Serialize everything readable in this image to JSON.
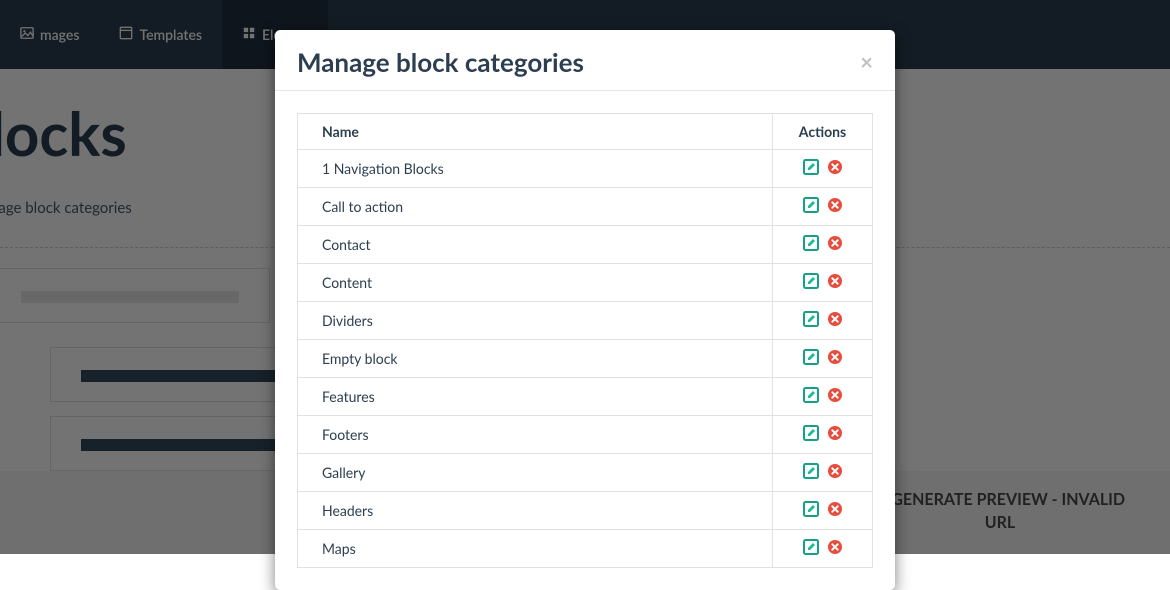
{
  "navbar": {
    "items": [
      {
        "label": "mages"
      },
      {
        "label": "Templates"
      },
      {
        "label": "Elemen"
      }
    ]
  },
  "page": {
    "title": "locks",
    "subtitle": "nage block categories",
    "preview_msg": "'T GENERATE PREVIEW - INVALID URL"
  },
  "modal": {
    "title": "Manage block categories",
    "columns": {
      "name": "Name",
      "actions": "Actions"
    },
    "rows": [
      {
        "name": "1 Navigation Blocks"
      },
      {
        "name": "Call to action"
      },
      {
        "name": "Contact"
      },
      {
        "name": "Content"
      },
      {
        "name": "Dividers"
      },
      {
        "name": "Empty block"
      },
      {
        "name": "Features"
      },
      {
        "name": "Footers"
      },
      {
        "name": "Gallery"
      },
      {
        "name": "Headers"
      },
      {
        "name": "Maps"
      }
    ]
  },
  "colors": {
    "edit": "#1abc9c",
    "edit_stroke": "#16a085",
    "delete": "#e74c3c"
  }
}
